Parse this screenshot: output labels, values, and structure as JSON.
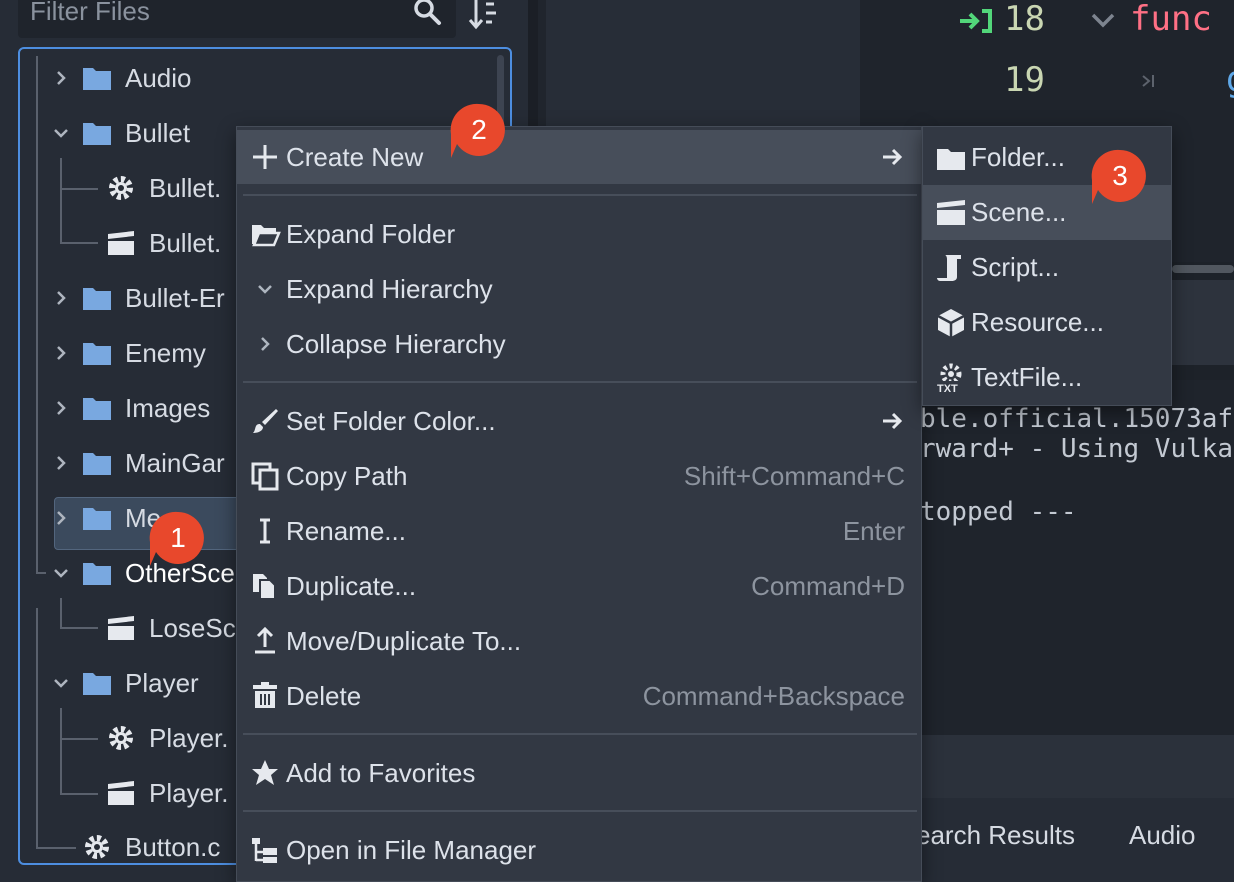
{
  "filesystem": {
    "filter_placeholder": "Filter Files",
    "tree": [
      {
        "label": "Audio",
        "type": "folder",
        "expanded": false
      },
      {
        "label": "Bullet",
        "type": "folder",
        "expanded": true
      },
      {
        "label": "Bullet.",
        "type": "script"
      },
      {
        "label": "Bullet.",
        "type": "scene"
      },
      {
        "label": "Bullet-Er",
        "type": "folder",
        "expanded": false
      },
      {
        "label": "Enemy",
        "type": "folder",
        "expanded": false
      },
      {
        "label": "Images",
        "type": "folder",
        "expanded": false
      },
      {
        "label": "MainGar",
        "type": "folder",
        "expanded": false
      },
      {
        "label": "Me",
        "type": "folder",
        "expanded": false
      },
      {
        "label": "OtherSce",
        "type": "folder",
        "expanded": true,
        "selected": true
      },
      {
        "label": "LoseSc",
        "type": "scene"
      },
      {
        "label": "Player",
        "type": "folder",
        "expanded": true
      },
      {
        "label": "Player.",
        "type": "script"
      },
      {
        "label": "Player.",
        "type": "scene"
      },
      {
        "label": "Button.c",
        "type": "script"
      }
    ]
  },
  "code": {
    "line_18": "18",
    "line_19": "19",
    "keyword": "func",
    "trailing_char": "g"
  },
  "output": {
    "line_1": "ble.official.15073af",
    "line_2": "rward+ - Using Vulka",
    "line_3": "topped ---"
  },
  "bottom_tabs": {
    "search_results": "earch Results",
    "audio": "Audio"
  },
  "context_menu": {
    "items": [
      {
        "label": "Create New",
        "icon": "plus-icon",
        "submenu": true
      },
      {
        "label": "Expand Folder",
        "icon": "folder-open-icon"
      },
      {
        "label": "Expand Hierarchy",
        "icon": "chevron-down-icon"
      },
      {
        "label": "Collapse Hierarchy",
        "icon": "chevron-right-icon"
      },
      {
        "label": "Set Folder Color...",
        "icon": "brush-icon",
        "submenu": true
      },
      {
        "label": "Copy Path",
        "icon": "copy-icon",
        "shortcut": "Shift+Command+C"
      },
      {
        "label": "Rename...",
        "icon": "rename-icon",
        "shortcut": "Enter"
      },
      {
        "label": "Duplicate...",
        "icon": "duplicate-icon",
        "shortcut": "Command+D"
      },
      {
        "label": "Move/Duplicate To...",
        "icon": "move-icon"
      },
      {
        "label": "Delete",
        "icon": "trash-icon",
        "shortcut": "Command+Backspace"
      },
      {
        "label": "Add to Favorites",
        "icon": "star-icon"
      },
      {
        "label": "Open in File Manager",
        "icon": "file-manager-icon"
      }
    ]
  },
  "submenu": {
    "items": [
      {
        "label": "Folder...",
        "icon": "folder-icon"
      },
      {
        "label": "Scene...",
        "icon": "scene-icon"
      },
      {
        "label": "Script...",
        "icon": "script-icon"
      },
      {
        "label": "Resource...",
        "icon": "resource-icon"
      },
      {
        "label": "TextFile...",
        "icon": "textfile-icon"
      }
    ]
  },
  "badges": {
    "b1": "1",
    "b2": "2",
    "b3": "3"
  },
  "colors": {
    "accent": "#4d8ee0",
    "folder": "#79a8e0",
    "badge": "#e8482c",
    "keyword": "#ff7085",
    "line_number": "#c9d6b2",
    "breakpoint_arrow": "#52d67a"
  }
}
